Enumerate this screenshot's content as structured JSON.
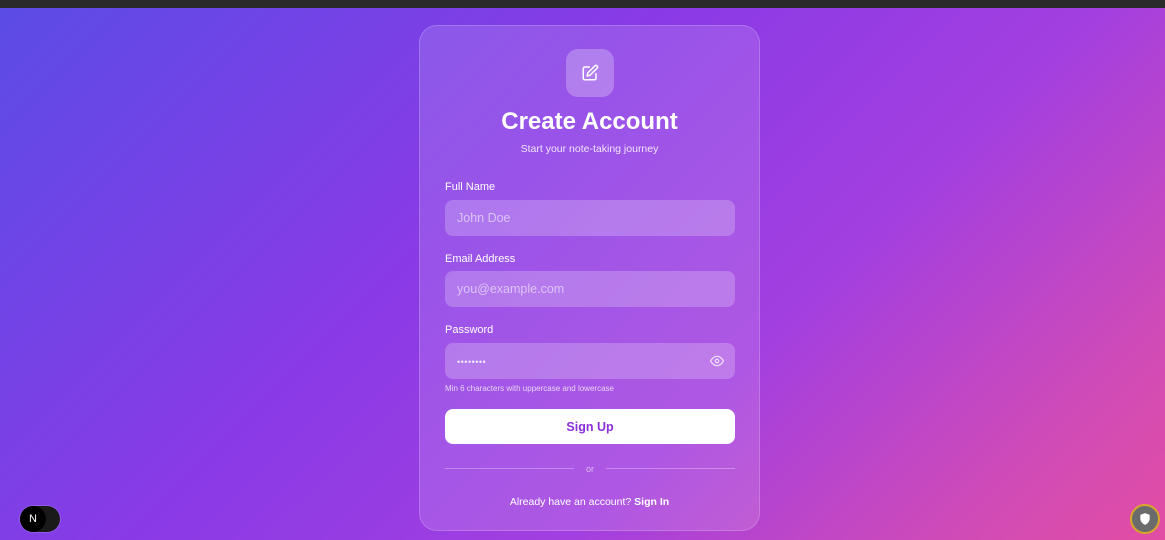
{
  "form": {
    "logo_icon": "edit-note-icon",
    "title": "Create Account",
    "subtitle": "Start your note-taking journey",
    "fields": {
      "full_name": {
        "label": "Full Name",
        "placeholder": "John Doe"
      },
      "email": {
        "label": "Email Address",
        "placeholder": "you@example.com"
      },
      "password": {
        "label": "Password",
        "masked_value": "••••••••",
        "toggle_icon": "eye-icon"
      }
    },
    "password_hint": "Min 6 characters with uppercase and lowercase",
    "submit_label": "Sign Up",
    "divider_text": "or",
    "footer_text": "Already have an account?",
    "footer_link": "Sign In"
  },
  "overlays": {
    "dev_badge_letter": "N",
    "extension_icon": "shield-extension-icon"
  },
  "colors": {
    "accent": "#8b2fd6",
    "gradient_start": "#5b4ce6",
    "gradient_end": "#e24da3"
  }
}
